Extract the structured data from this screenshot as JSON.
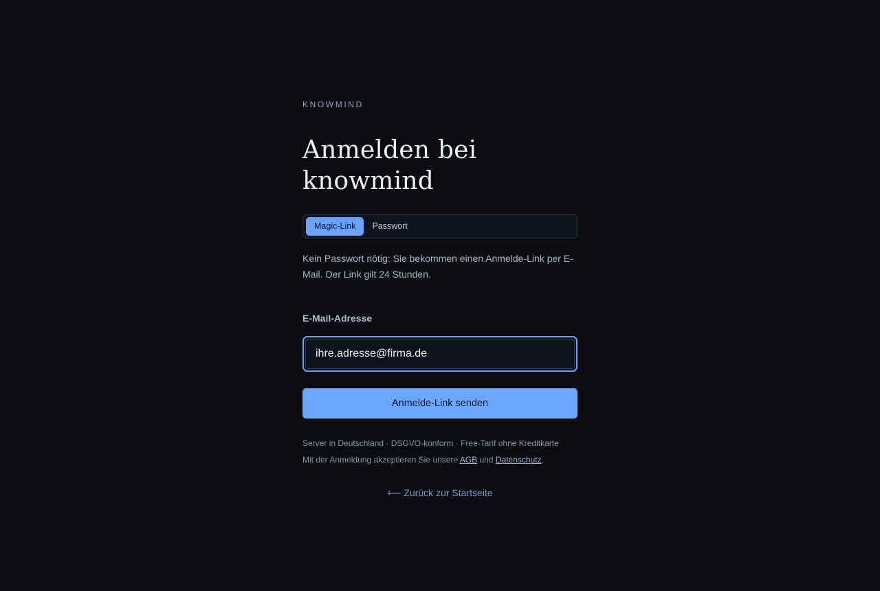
{
  "brand": "KNOWMIND",
  "title_line1": "Anmelden bei",
  "title_line2": "knowmind",
  "tabs": [
    {
      "label": "Magic-Link",
      "active": true
    },
    {
      "label": "Passwort",
      "active": false
    }
  ],
  "description": "Kein Passwort nötig: Sie bekommen einen Anmelde-Link per E-Mail. Der Link gilt 24 Stunden.",
  "email": {
    "label": "E-Mail-Adresse",
    "placeholder": "ihre.adresse@firma.de",
    "value": ""
  },
  "submit_label": "Anmelde-Link senden",
  "footer": {
    "trust_line": "Server in Deutschland · DSGVO-konform · Free-Tarif ohne Kreditkarte",
    "terms_prefix": "Mit der Anmeldung akzeptieren Sie unsere",
    "agb_label": "AGB",
    "terms_joiner": "und",
    "privacy_label": "Datenschutz",
    "terms_suffix": "."
  },
  "back_link": "⟵ Zurück zur Startseite",
  "colors": {
    "background": "#0a0c10",
    "accent": "#6aa3ff"
  }
}
